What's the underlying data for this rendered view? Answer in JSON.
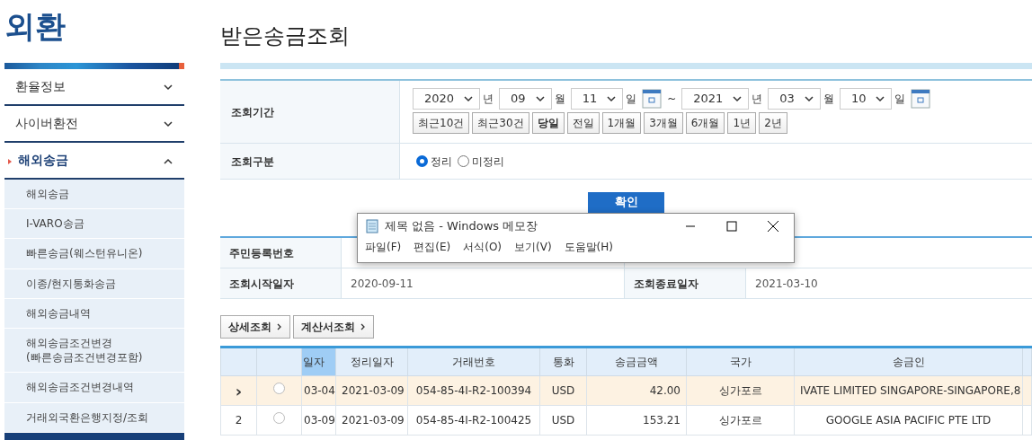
{
  "sidebar": {
    "title": "외환",
    "menus": [
      {
        "label": "환율정보",
        "expanded": false
      },
      {
        "label": "사이버환전",
        "expanded": false
      },
      {
        "label": "해외송금",
        "expanded": true,
        "children": [
          {
            "label": "해외송금"
          },
          {
            "label": "I-VARO송금"
          },
          {
            "label": "빠른송금(웨스턴유니온)"
          },
          {
            "label": "이종/현지통화송금"
          },
          {
            "label": "해외송금내역"
          },
          {
            "label": "해외송금조건변경\n(빠른송금조건변경포함)"
          },
          {
            "label": "해외송금조건변경내역"
          },
          {
            "label": "거래외국환은행지정/조회"
          }
        ]
      }
    ]
  },
  "page_title": "받은송금조회",
  "search_form": {
    "period_label": "조회기간",
    "from": [
      {
        "value": "2020",
        "unit": "년"
      },
      {
        "value": "09",
        "unit": "월"
      },
      {
        "value": "11",
        "unit": "일"
      }
    ],
    "separator": "~",
    "to": [
      {
        "value": "2021",
        "unit": "년"
      },
      {
        "value": "03",
        "unit": "월"
      },
      {
        "value": "10",
        "unit": "일"
      }
    ],
    "quick_buttons": [
      {
        "label": "최근10건",
        "selected": false
      },
      {
        "label": "최근30건",
        "selected": false
      },
      {
        "label": "당일",
        "selected": true
      },
      {
        "label": "전일",
        "selected": false
      },
      {
        "label": "1개월",
        "selected": false
      },
      {
        "label": "3개월",
        "selected": false
      },
      {
        "label": "6개월",
        "selected": false
      },
      {
        "label": "1년",
        "selected": false
      },
      {
        "label": "2년",
        "selected": false
      }
    ],
    "type_label": "조회구분",
    "type_options": [
      {
        "label": "정리",
        "selected": true
      },
      {
        "label": "미정리",
        "selected": false
      }
    ],
    "submit": "확인"
  },
  "info": [
    {
      "label": "주민등록번호"
    },
    {
      "label": "조회시작일자",
      "value": "2020-09-11",
      "label_2": "조회종료일자",
      "value_2": "2021-03-10"
    }
  ],
  "action_buttons": [
    "상세조회",
    "계산서조회"
  ],
  "grid": {
    "columns": [
      {
        "label": "일자",
        "selected": true,
        "kind": "text"
      },
      {
        "label": "정리일자",
        "selected": false,
        "kind": "text"
      },
      {
        "label": "거래번호",
        "selected": false,
        "kind": "text"
      },
      {
        "label": "통화",
        "selected": false,
        "kind": "text"
      },
      {
        "label": "송금금액",
        "selected": false,
        "kind": "amount"
      },
      {
        "label": "국가",
        "selected": false,
        "kind": "text"
      },
      {
        "label": "송금인",
        "selected": false,
        "kind": "text"
      }
    ],
    "rows": [
      {
        "selected": true,
        "indicator": "›",
        "checked": false,
        "cells": [
          "03-04",
          "2021-03-09",
          "054-85-4I-R2-100394",
          "USD",
          "42.00",
          "싱가포르",
          "IVATE LIMITED SINGAPORE-SINGAPORE,8"
        ]
      },
      {
        "selected": false,
        "indicator": "2",
        "checked": false,
        "cells": [
          "03-09",
          "2021-03-09",
          "054-85-4I-R2-100425",
          "USD",
          "153.21",
          "싱가포르",
          "GOOGLE ASIA PACIFIC PTE LTD"
        ]
      }
    ]
  },
  "notepad": {
    "title": "제목 없음 - Windows 메모장",
    "menu": [
      "파일(F)",
      "편집(E)",
      "서식(O)",
      "보기(V)",
      "도움말(H)"
    ]
  }
}
